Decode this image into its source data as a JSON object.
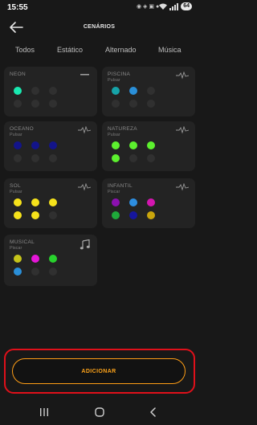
{
  "status": {
    "time": "15:55",
    "notif_icons": "◉ ◈ ▣ ●",
    "battery": "64"
  },
  "header": {
    "title": "CENÁRIOS",
    "back_icon": "arrow-left-icon"
  },
  "tabs": [
    "Todos",
    "Estático",
    "Alternado",
    "Música"
  ],
  "cards": [
    {
      "name": "NEON",
      "subtitle": "",
      "icon": "minus-icon",
      "dots": [
        "#19e8b0",
        "#303030",
        "#303030",
        "#303030",
        "#303030",
        "#303030"
      ]
    },
    {
      "name": "PISCINA",
      "subtitle": "Pulsar",
      "icon": "pulse-wave-icon",
      "dots": [
        "#16a3a8",
        "#2a8fd8",
        "#303030",
        "#303030",
        "#303030",
        "#303030"
      ]
    },
    {
      "name": "OCEANO",
      "subtitle": "Pulsar",
      "icon": "pulse-wave-icon",
      "dots": [
        "#13148a",
        "#13148a",
        "#13148a",
        "#303030",
        "#303030",
        "#303030"
      ]
    },
    {
      "name": "NATUREZA",
      "subtitle": "Pulsar",
      "icon": "pulse-wave-icon",
      "dots": [
        "#5cf02e",
        "#5cf02e",
        "#5cf02e",
        "#5cf02e",
        "#303030",
        "#303030"
      ]
    },
    {
      "name": "SOL",
      "subtitle": "Pulsar",
      "icon": "pulse-wave-icon",
      "dots": [
        "#f6e21b",
        "#f6e21b",
        "#f6e21b",
        "#f6e21b",
        "#f6e21b",
        "#303030"
      ]
    },
    {
      "name": "INFANTIL",
      "subtitle": "Piscar",
      "icon": "pulse-wave-icon",
      "dots": [
        "#8b10b0",
        "#2d8ee0",
        "#d316b0",
        "#1fa83a",
        "#16169e",
        "#c9a50c"
      ]
    },
    {
      "name": "MUSICAL",
      "subtitle": "Piscar",
      "icon": "music-note-icon",
      "dots": [
        "#c5c41a",
        "#e516d8",
        "#28d22d",
        "#2a8fd8",
        "#303030",
        "#303030"
      ]
    }
  ],
  "add_button": {
    "label": "ADICIONAR"
  },
  "colors": {
    "accent": "#ffa41a",
    "highlight_border": "#e0101a",
    "background": "#181818",
    "card": "#232323"
  },
  "navbar": {
    "items": [
      "recent-apps-icon",
      "home-icon",
      "back-chevron-icon"
    ]
  }
}
